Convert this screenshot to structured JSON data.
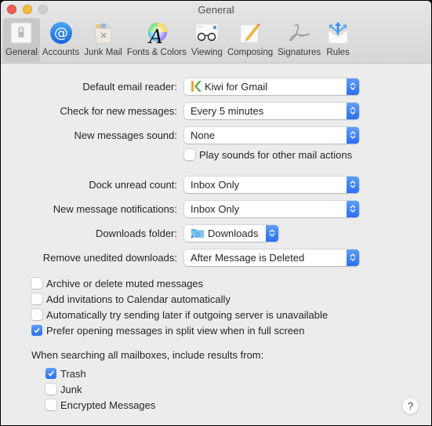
{
  "window": {
    "title": "General"
  },
  "toolbar": {
    "items": [
      {
        "label": "General",
        "icon": "general-switch-icon",
        "active": true
      },
      {
        "label": "Accounts",
        "icon": "at-sign-icon",
        "active": false
      },
      {
        "label": "Junk Mail",
        "icon": "junk-trash-icon",
        "active": false
      },
      {
        "label": "Fonts & Colors",
        "icon": "fonts-colors-icon",
        "active": false
      },
      {
        "label": "Viewing",
        "icon": "glasses-icon",
        "active": false
      },
      {
        "label": "Composing",
        "icon": "pencil-icon",
        "active": false
      },
      {
        "label": "Signatures",
        "icon": "signature-icon",
        "active": false
      },
      {
        "label": "Rules",
        "icon": "rules-envelope-icon",
        "active": false
      }
    ]
  },
  "settings": {
    "default_email_reader": {
      "label": "Default email reader:",
      "value": "Kiwi for Gmail",
      "icon": "kiwi-app-icon"
    },
    "check_new_messages": {
      "label": "Check for new messages:",
      "value": "Every 5 minutes"
    },
    "new_messages_sound": {
      "label": "New messages sound:",
      "value": "None"
    },
    "play_sounds": {
      "label": "Play sounds for other mail actions",
      "checked": false
    },
    "dock_unread_count": {
      "label": "Dock unread count:",
      "value": "Inbox Only"
    },
    "new_message_notifications": {
      "label": "New message notifications:",
      "value": "Inbox Only"
    },
    "downloads_folder": {
      "label": "Downloads folder:",
      "value": "Downloads",
      "icon": "downloads-folder-icon"
    },
    "remove_unedited_downloads": {
      "label": "Remove unedited downloads:",
      "value": "After Message is Deleted"
    }
  },
  "options": [
    {
      "label": "Archive or delete muted messages",
      "checked": false
    },
    {
      "label": "Add invitations to Calendar automatically",
      "checked": false
    },
    {
      "label": "Automatically try sending later if outgoing server is unavailable",
      "checked": false
    },
    {
      "label": "Prefer opening messages in split view when in full screen",
      "checked": true
    }
  ],
  "search": {
    "label": "When searching all mailboxes, include results from:",
    "items": [
      {
        "label": "Trash",
        "checked": true
      },
      {
        "label": "Junk",
        "checked": false
      },
      {
        "label": "Encrypted Messages",
        "checked": false
      }
    ]
  },
  "help": {
    "label": "?"
  },
  "colors": {
    "accent": "#2a6ff0",
    "window_bg": "#ececec"
  }
}
